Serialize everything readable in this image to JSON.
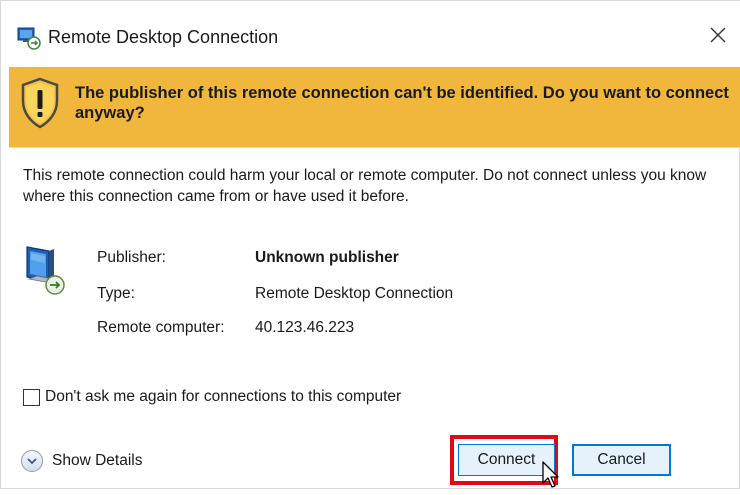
{
  "window": {
    "title": "Remote Desktop Connection",
    "close_symbol": "X"
  },
  "banner": {
    "message": "The publisher of this remote connection can't be identified. Do you want to connect anyway?",
    "color": "#f1b73c"
  },
  "body": {
    "warning": "This remote connection could harm your local or remote computer. Do not connect unless you know where this connection came from or have used it before."
  },
  "details": [
    {
      "label": "Publisher:",
      "value": "Unknown publisher"
    },
    {
      "label": "Type:",
      "value": "Remote Desktop Connection"
    },
    {
      "label": "Remote computer:",
      "value": "40.123.46.223"
    }
  ],
  "checkbox": {
    "label": "Don't ask me again for connections to this computer",
    "checked": false
  },
  "footer": {
    "show_details_label": "Show Details",
    "connect_label": "Connect",
    "cancel_label": "Cancel",
    "highlight_color": "#e30613",
    "accent_color": "#0078d7"
  },
  "icons": {
    "app": "remote-desktop-icon",
    "warning": "warning-shield-icon",
    "computer": "remote-computer-icon",
    "expand": "chevron-down-icon",
    "close": "close-icon",
    "cursor": "mouse-pointer-icon"
  }
}
